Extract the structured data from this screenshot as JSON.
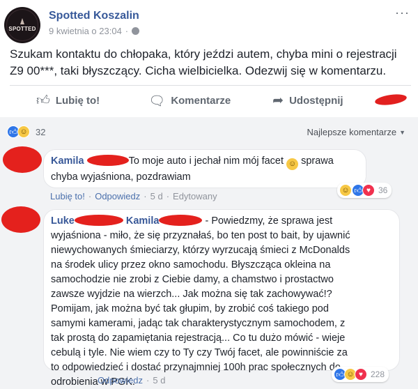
{
  "post": {
    "page_logo_text": "SPOTTED",
    "page_name": "Spotted Koszalin",
    "timestamp": "9 kwietnia o 23:04",
    "meta_separator": "·",
    "text": "Szukam kontaktu do chłopaka, który jeździ autem, chyba mini o rejestracji Z9 00***, taki błyszczący. Cicha wielbicielka. Odezwij się w komentarzu."
  },
  "actions": {
    "like_label": "Lubię to!",
    "comment_label": "Komentarze",
    "share_label": "Udostępnij"
  },
  "reactions": {
    "count": "32"
  },
  "sort": {
    "label": "Najlepsze komentarze"
  },
  "comments": [
    {
      "author_prefix": "Kamila",
      "text_line1": "To moje auto i jechał nim mój facet",
      "text_line1_tail": "sprawa",
      "text_line2": "chyba wyjaśniona, pozdrawiam",
      "like_label": "Lubię to!",
      "reply_label": "Odpowiedz",
      "time": "5 d",
      "edited_label": "Edytowany",
      "reaction_count": "36"
    },
    {
      "author_prefix": "Luke",
      "mention_prefix": "Kamila",
      "lines": [
        "- Powiedzmy, że sprawa jest",
        "wyjaśniona - miło, że się przyznałaś, bo ten post to bait, by ujawnić",
        "niewychowanych śmieciarzy, którzy wyrzucają śmieci z McDonalds",
        "na środek ulicy przez okno samochodu. Błyszcząca okleina na",
        "samochodzie nie zrobi z Ciebie damy, a chamstwo i prostactwo",
        "zawsze wyjdzie na wierzch... Jak można się tak zachowywać!?",
        "Pomijam, jak można być tak głupim, by zrobić coś takiego pod",
        "samymi kamerami, jadąc tak charakterystycznym samochodem, z",
        "tak prostą do zapamiętania rejestracją... Co tu dużo mówić - wieje",
        "cebulą i tyle. Nie wiem czy to Ty czy Twój facet, ale powinniście za",
        "to odpowiedzieć i dostać przynajmniej 100h prac społecznych do",
        "odrobienia w PGK."
      ],
      "reply_label": "Odpowiedz",
      "time": "5 d",
      "reaction_count": "228"
    }
  ],
  "colors": {
    "link_blue": "#365899",
    "comment_name_blue": "#385898",
    "redaction_red": "#e4211d",
    "like_blue": "#2f76e8",
    "haha_yellow": "#f7c845",
    "love_red": "#f0314e",
    "comment_bg": "#f2f3f5"
  },
  "icons": {
    "post_menu": "more-horizontal-icon",
    "privacy": "globe-icon",
    "like": "thumbs-up-icon",
    "comment": "speech-bubble-icon",
    "share": "share-arrow-icon"
  }
}
